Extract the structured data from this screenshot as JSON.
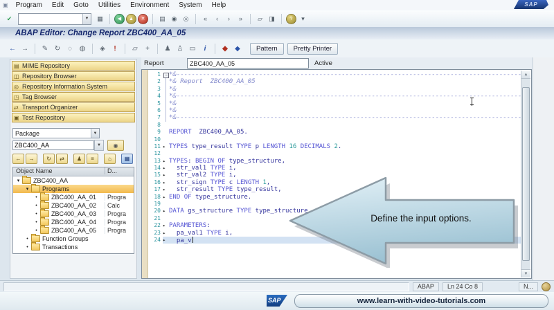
{
  "window": {
    "logo_text": "SAP"
  },
  "menu_bar": {
    "system_icon": "▣",
    "items": [
      "Program",
      "Edit",
      "Goto",
      "Utilities",
      "Environment",
      "System",
      "Help"
    ]
  },
  "standard_toolbar": {
    "enter_icon_glyph": "✔",
    "command_value": "",
    "icons": [
      {
        "name": "save-icon",
        "glyph": "▦"
      },
      {
        "sep": true
      },
      {
        "name": "back-icon",
        "glyph": "◀",
        "cls": "ball green"
      },
      {
        "name": "exit-icon",
        "glyph": "▲",
        "cls": "ball olive"
      },
      {
        "name": "cancel-icon",
        "glyph": "✕",
        "cls": "ball red"
      },
      {
        "sep": true
      },
      {
        "name": "print-icon",
        "glyph": "▤"
      },
      {
        "name": "find-icon",
        "glyph": "◉"
      },
      {
        "name": "find-next-icon",
        "glyph": "◎"
      },
      {
        "sep": true
      },
      {
        "name": "first-page-icon",
        "glyph": "«"
      },
      {
        "name": "page-up-icon",
        "glyph": "‹"
      },
      {
        "name": "page-down-icon",
        "glyph": "›"
      },
      {
        "name": "last-page-icon",
        "glyph": "»"
      },
      {
        "sep": true
      },
      {
        "name": "new-session-icon",
        "glyph": "▱"
      },
      {
        "name": "create-shortcut-icon",
        "glyph": "◨"
      },
      {
        "sep": true
      },
      {
        "name": "help-icon",
        "glyph": "?",
        "cls": "ball olive"
      },
      {
        "name": "layout-menu-icon",
        "glyph": "▾"
      }
    ]
  },
  "title_bar": {
    "title": "ABAP Editor: Change Report ZBC400_AA_05"
  },
  "app_toolbar": {
    "icons": [
      {
        "name": "back-icon",
        "glyph": "←",
        "cls": "blue"
      },
      {
        "name": "forward-icon",
        "glyph": "→"
      },
      {
        "sep": true
      },
      {
        "name": "display-change-icon",
        "glyph": "✎"
      },
      {
        "name": "refresh-icon",
        "glyph": "↻"
      },
      {
        "name": "other-object-icon",
        "glyph": "◌"
      },
      {
        "name": "inactive-version-icon",
        "glyph": "◍"
      },
      {
        "sep": true
      },
      {
        "name": "where-used-icon",
        "glyph": "◈"
      },
      {
        "name": "syntax-check-icon",
        "glyph": "!",
        "cls": "red"
      },
      {
        "sep": true
      },
      {
        "name": "copy-icon",
        "glyph": "▱"
      },
      {
        "name": "navigation-icon",
        "glyph": "+"
      },
      {
        "sep": true
      },
      {
        "name": "test-icon",
        "glyph": "♟"
      },
      {
        "name": "debug-icon",
        "glyph": "♙"
      },
      {
        "name": "screen-icon",
        "glyph": "▭"
      },
      {
        "name": "info-icon",
        "glyph": "i",
        "cls": "blue bold"
      },
      {
        "sep": true
      },
      {
        "name": "activate-icon",
        "glyph": "◆",
        "cls": "red"
      },
      {
        "name": "transport-icon",
        "glyph": "◆",
        "cls": "blue"
      }
    ],
    "buttons": [
      "Pattern",
      "Pretty Printer"
    ]
  },
  "sidebar": {
    "nav_buttons": [
      {
        "label": "MIME Repository",
        "icon_name": "mime-repository-icon",
        "glyph": "▤"
      },
      {
        "label": "Repository Browser",
        "icon_name": "repository-browser-icon",
        "glyph": "◫"
      },
      {
        "label": "Repository Information System",
        "icon_name": "repository-infosystem-icon",
        "glyph": "◎"
      },
      {
        "label": "Tag Browser",
        "icon_name": "tag-browser-icon",
        "glyph": "◳"
      },
      {
        "label": "Transport Organizer",
        "icon_name": "transport-organizer-icon",
        "glyph": "⇄"
      },
      {
        "label": "Test Repository",
        "icon_name": "test-repository-icon",
        "glyph": "▣"
      }
    ],
    "browse_select": "Package",
    "package_value": "ZBC400_AA",
    "tool_icons": [
      {
        "name": "history-back-icon",
        "glyph": "←"
      },
      {
        "name": "history-forward-icon",
        "glyph": "→"
      },
      {
        "name": "refresh-icon",
        "glyph": "↻",
        "gap": true
      },
      {
        "name": "refresh-subtree-icon",
        "glyph": "⇄"
      },
      {
        "name": "worklist-icon",
        "glyph": "♟",
        "gap": true
      },
      {
        "name": "object-list-icon",
        "glyph": "≡"
      },
      {
        "name": "favorites-icon",
        "glyph": "⌂",
        "gap": true
      },
      {
        "name": "settings-icon",
        "glyph": "▦",
        "cls": "blue",
        "gap": true
      }
    ],
    "tree": {
      "columns": [
        "Object Name",
        "D..."
      ],
      "rows": [
        {
          "label": "ZBC400_AA",
          "desc": "",
          "indent": 0,
          "marker": "open",
          "selected": false
        },
        {
          "label": "Programs",
          "desc": "",
          "indent": 1,
          "marker": "open",
          "selected": true
        },
        {
          "label": "ZBC400_AA_01",
          "desc": "Progra",
          "indent": 2,
          "marker": "leaf",
          "selected": false
        },
        {
          "label": "ZBC400_AA_02",
          "desc": "Calc",
          "indent": 2,
          "marker": "leaf",
          "selected": false
        },
        {
          "label": "ZBC400_AA_03",
          "desc": "Progra",
          "indent": 2,
          "marker": "leaf",
          "selected": false
        },
        {
          "label": "ZBC400_AA_04",
          "desc": "Progra",
          "indent": 2,
          "marker": "leaf",
          "selected": false
        },
        {
          "label": "ZBC400_AA_05",
          "desc": "Progra",
          "indent": 2,
          "marker": "leaf",
          "selected": false
        },
        {
          "label": "Function Groups",
          "desc": "",
          "indent": 1,
          "marker": "leaf",
          "selected": false
        },
        {
          "label": "Transactions",
          "desc": "",
          "indent": 1,
          "marker": "leaf",
          "selected": false
        }
      ]
    }
  },
  "editor": {
    "report_label": "Report",
    "report_value": "ZBC400_AA_05",
    "status": "Active",
    "lines": [
      {
        "n": 1,
        "t": "*&--------------------------------------------------------------------------------------------------",
        "fold": "box"
      },
      {
        "n": 2,
        "t": "*& Report  ZBC400_AA_05",
        "fold": "line"
      },
      {
        "n": 3,
        "t": "*&",
        "fold": "line"
      },
      {
        "n": 4,
        "t": "*&--------------------------------------------------------------------------------------------------",
        "fold": "line"
      },
      {
        "n": 5,
        "t": "*&",
        "fold": "line"
      },
      {
        "n": 6,
        "t": "*&",
        "fold": "line"
      },
      {
        "n": 7,
        "t": "*&--------------------------------------------------------------------------------------------------",
        "fold": "line"
      },
      {
        "n": 8,
        "t": ""
      },
      {
        "n": 9,
        "t": "REPORT  ZBC400_AA_05."
      },
      {
        "n": 10,
        "t": ""
      },
      {
        "n": 11,
        "t": "TYPES type_result TYPE p LENGTH 16 DECIMALS 2.",
        "fold": "tri"
      },
      {
        "n": 12,
        "t": ""
      },
      {
        "n": 13,
        "t": "TYPES: BEGIN OF type_structure,",
        "fold": "tri"
      },
      {
        "n": 14,
        "t": "  str_val1 TYPE i,",
        "fold": "tri"
      },
      {
        "n": 15,
        "t": "  str_val2 TYPE i,",
        "fold": "tri"
      },
      {
        "n": 16,
        "t": "  str_sign TYPE c LENGTH 1,",
        "fold": "tri"
      },
      {
        "n": 17,
        "t": "  str_result TYPE type_result,",
        "fold": "tri"
      },
      {
        "n": 18,
        "t": "END OF type_structure.",
        "fold": "tri"
      },
      {
        "n": 19,
        "t": ""
      },
      {
        "n": 20,
        "t": "DATA gs_structure TYPE type_structure.",
        "fold": "tri"
      },
      {
        "n": 21,
        "t": ""
      },
      {
        "n": 22,
        "t": "PARAMETERS:",
        "fold": "tri"
      },
      {
        "n": 23,
        "t": "  pa_val1 TYPE i,",
        "fold": "tri"
      },
      {
        "n": 24,
        "t": "  pa_v",
        "fold": "tri",
        "current": true,
        "cursor": true
      }
    ]
  },
  "annotation": {
    "text": "Define the input options."
  },
  "status_bar": {
    "system": "ABAP",
    "position": "Ln 24 Co 8",
    "right_text": "N..."
  },
  "banner": {
    "logo_text": "SAP",
    "url": "www.learn-with-video-tutorials.com"
  },
  "colors": {
    "titlebar_text": "#16286e",
    "sidebar_button": "#ecd488",
    "selection_orange": "#f2b94d",
    "editor_line_highlight": "#d3e2f3",
    "annotation_fill": "#aecfdf",
    "sap_blue": "#1e5bb0"
  }
}
